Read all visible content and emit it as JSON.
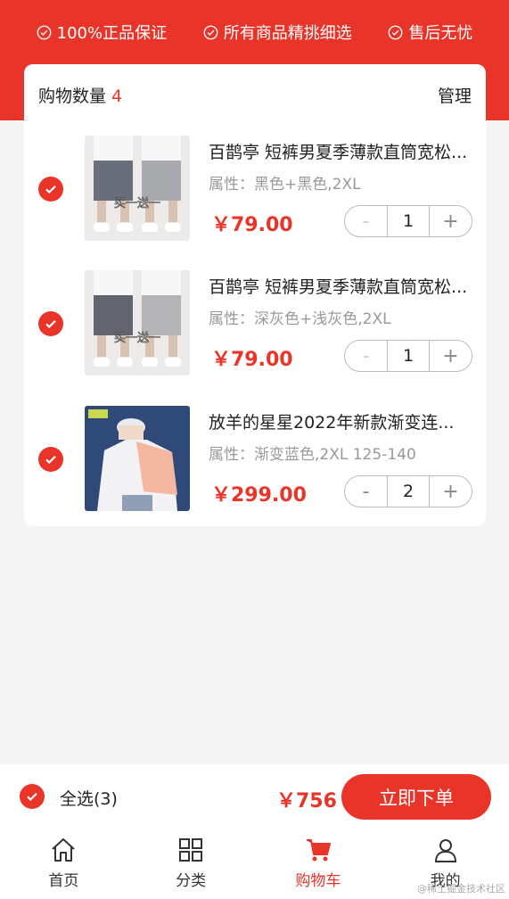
{
  "colors": {
    "accent": "#e9342a",
    "background": "#f4f4f4"
  },
  "guarantees": [
    {
      "icon": "check-circle-icon",
      "label": "100%正品保证"
    },
    {
      "icon": "check-circle-icon",
      "label": "所有商品精挑细选"
    },
    {
      "icon": "check-circle-icon",
      "label": "售后无忧"
    }
  ],
  "cart": {
    "count_label": "购物数量",
    "count": "4",
    "manage_label": "管理",
    "items": [
      {
        "title": "百鹊亭 短裤男夏季薄款直筒宽松...",
        "attrs": "属性：黑色+黑色,2XL",
        "price": "￥79.00",
        "qty": "1",
        "minus": "-",
        "plus": "+",
        "thumb_caption": "买一送一"
      },
      {
        "title": "百鹊亭 短裤男夏季薄款直筒宽松...",
        "attrs": "属性：深灰色+浅灰色,2XL",
        "price": "￥79.00",
        "qty": "1",
        "minus": "-",
        "plus": "+",
        "thumb_caption": "买一送一"
      },
      {
        "title": "放羊的星星2022年新款渐变连...",
        "attrs": "属性：渐变蓝色,2XL 125-140",
        "price": "￥299.00",
        "qty": "2",
        "minus": "-",
        "plus": "+"
      }
    ]
  },
  "checkout": {
    "select_all_label": "全选(3)",
    "total": "￥756",
    "order_button": "立即下单"
  },
  "tabbar": [
    {
      "icon": "home-icon",
      "label": "首页",
      "active": false
    },
    {
      "icon": "grid-icon",
      "label": "分类",
      "active": false
    },
    {
      "icon": "cart-icon",
      "label": "购物车",
      "active": true
    },
    {
      "icon": "user-icon",
      "label": "我的",
      "active": false
    }
  ],
  "watermark": "@稀土掘金技术社区"
}
